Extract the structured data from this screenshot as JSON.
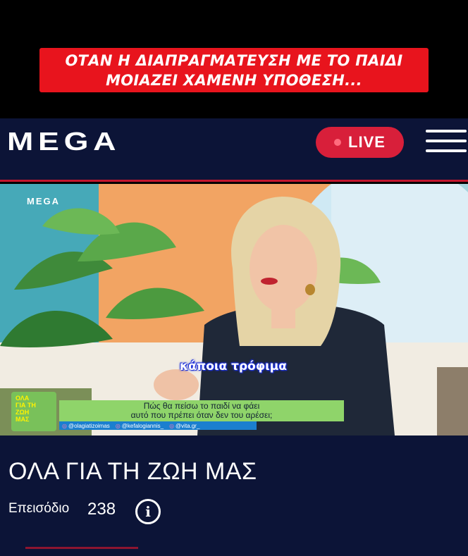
{
  "overlay_caption": {
    "line1": "ΟΤΑΝ Η ΔΙΑΠΡΑΓΜΑΤΕΥΣΗ ΜΕ ΤΟ ΠΑΙΔΙ",
    "line2": "ΜΟΙΑΖΕΙ ΧΑΜΕΝΗ ΥΠΟΘΕΣΗ..."
  },
  "header": {
    "logo_text": "MEGA",
    "live_label": "LIVE",
    "menu_icon": "hamburger-menu-icon"
  },
  "video": {
    "watermark": "MEGA",
    "subtitle": "κάποια τρόφιμα",
    "badge_text": [
      "ΟΛΑ",
      "ΓΙΑ ΤΗ",
      "ΖΩΗ",
      "ΜΑΣ"
    ],
    "lower_third": {
      "line1": "Πώς θα πείσω το παιδί να φάει",
      "line2": "αυτό που πρέπει όταν δεν του αρέσει;"
    },
    "social_handles": [
      "@olagiatizoimas",
      "@kefalogiannis_",
      "@vita.gr_"
    ]
  },
  "show": {
    "title": "ΟΛΑ ΓΙΑ ΤΗ ΖΩΗ ΜΑΣ",
    "episode_label": "Επεισόδιο",
    "episode_number": "238",
    "info_icon": "info-icon"
  },
  "colors": {
    "banner_red": "#e8141d",
    "navy": "#0c1437",
    "live_red": "#d81f3a"
  }
}
